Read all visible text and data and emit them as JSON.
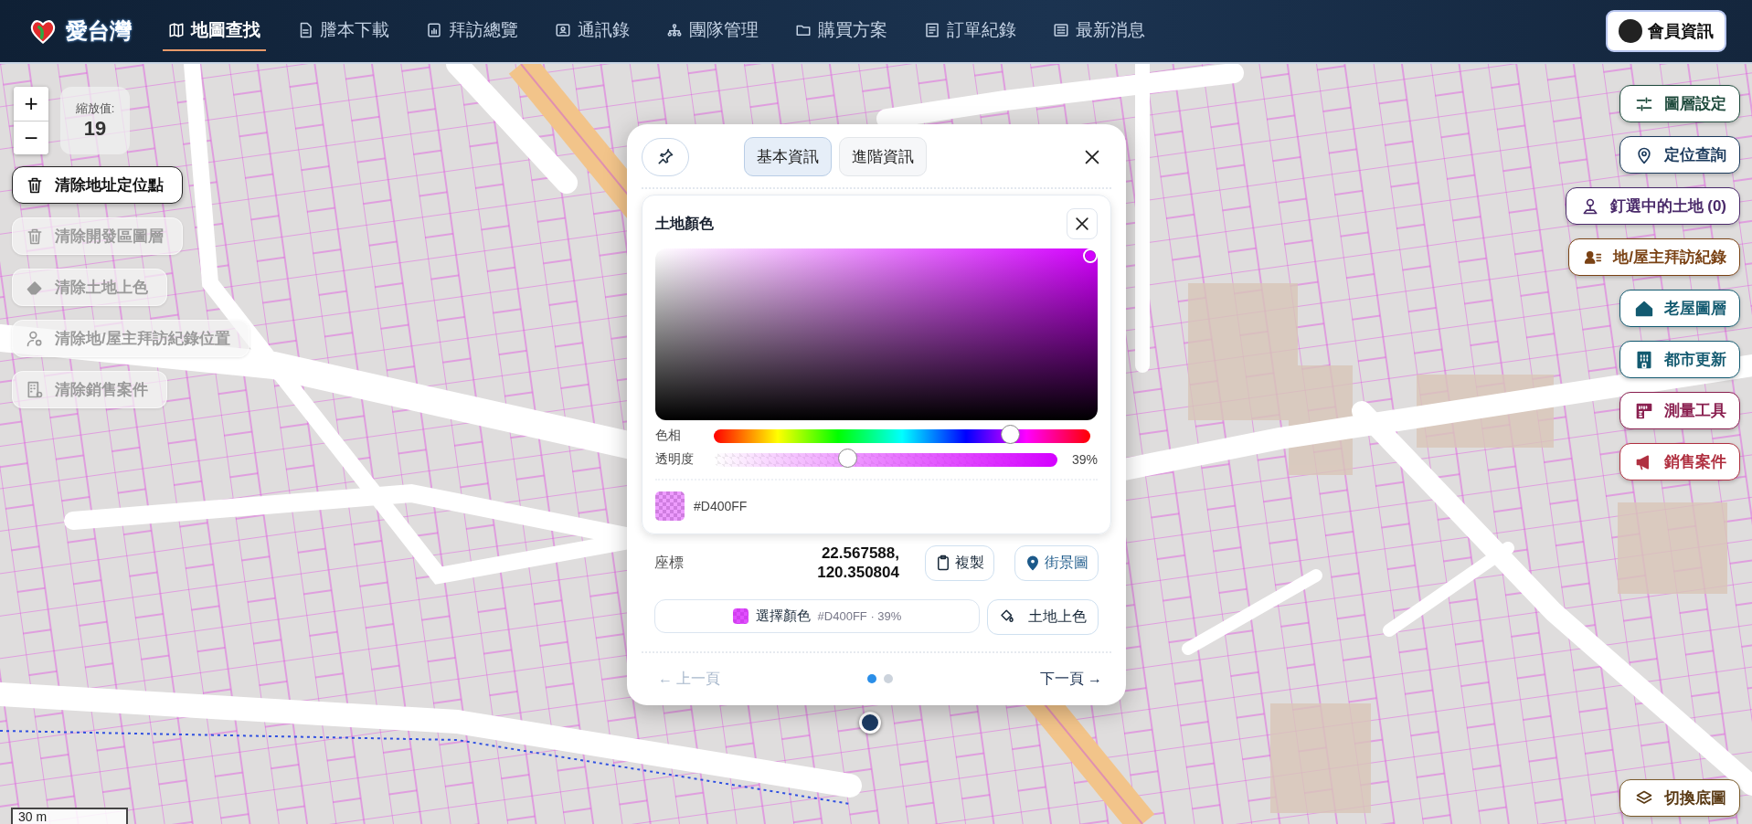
{
  "header": {
    "logo": "愛台灣",
    "nav": [
      {
        "label": "地圖查找",
        "selected": true
      },
      {
        "label": "謄本下載",
        "selected": false
      },
      {
        "label": "拜訪總覽",
        "selected": false
      },
      {
        "label": "通訊錄",
        "selected": false
      },
      {
        "label": "團隊管理",
        "selected": false
      },
      {
        "label": "購買方案",
        "selected": false
      },
      {
        "label": "訂單紀錄",
        "selected": false
      },
      {
        "label": "最新消息",
        "selected": false
      }
    ],
    "member_button": "會員資訊"
  },
  "zoom": {
    "zoom_in": "+",
    "zoom_out": "−",
    "label": "縮放值:",
    "value": "19"
  },
  "clear_buttons": [
    {
      "label": "清除地址定位點",
      "disabled": false
    },
    {
      "label": "清除開發區圖層",
      "disabled": true
    },
    {
      "label": "清除土地上色",
      "disabled": true
    },
    {
      "label": "清除地/屋主拜訪紀錄位置",
      "disabled": true
    },
    {
      "label": "清除銷售案件",
      "disabled": true
    }
  ],
  "right_tools": [
    {
      "label": "圖層設定",
      "color": "#1e4a3c"
    },
    {
      "label": "定位查詢",
      "color": "#1b3a5c"
    },
    {
      "label": "釘選中的土地 (0)",
      "color": "#4a2a6a"
    },
    {
      "label": "地/屋主拜訪紀錄",
      "color": "#7a4214"
    },
    {
      "label": "老屋圖層",
      "color": "#135a70"
    },
    {
      "label": "都市更新",
      "color": "#135a70"
    },
    {
      "label": "測量工具",
      "color": "#8a2050"
    },
    {
      "label": "銷售案件",
      "color": "#b03040"
    }
  ],
  "popup": {
    "tabs": [
      {
        "label": "基本資訊",
        "selected": true
      },
      {
        "label": "進階資訊",
        "selected": false
      }
    ],
    "color_panel": {
      "title": "土地顏色",
      "color": "#d400ff",
      "hue": {
        "label": "色相",
        "level": 0.79
      },
      "opacity": {
        "label": "透明度",
        "level": 0.39,
        "reading": "39%"
      },
      "hex_text": "#D400FF"
    },
    "coordinates": {
      "label": "座標",
      "lines": [
        "22.567588,",
        "120.350804"
      ],
      "copy_button": "複製",
      "street_view_button": "街景圖"
    },
    "choose_color": {
      "label": "選擇顏色",
      "meta": "#D400FF · 39%"
    },
    "paint_button": "土地上色",
    "prev": {
      "label": "← 上一頁",
      "disabled": true
    },
    "pages": [
      {
        "selected": true
      },
      {
        "selected": false
      }
    ],
    "next": {
      "label": "下一頁 →",
      "disabled": false
    }
  },
  "scale_bar": "30 m",
  "basemap_button": "切換底圖"
}
